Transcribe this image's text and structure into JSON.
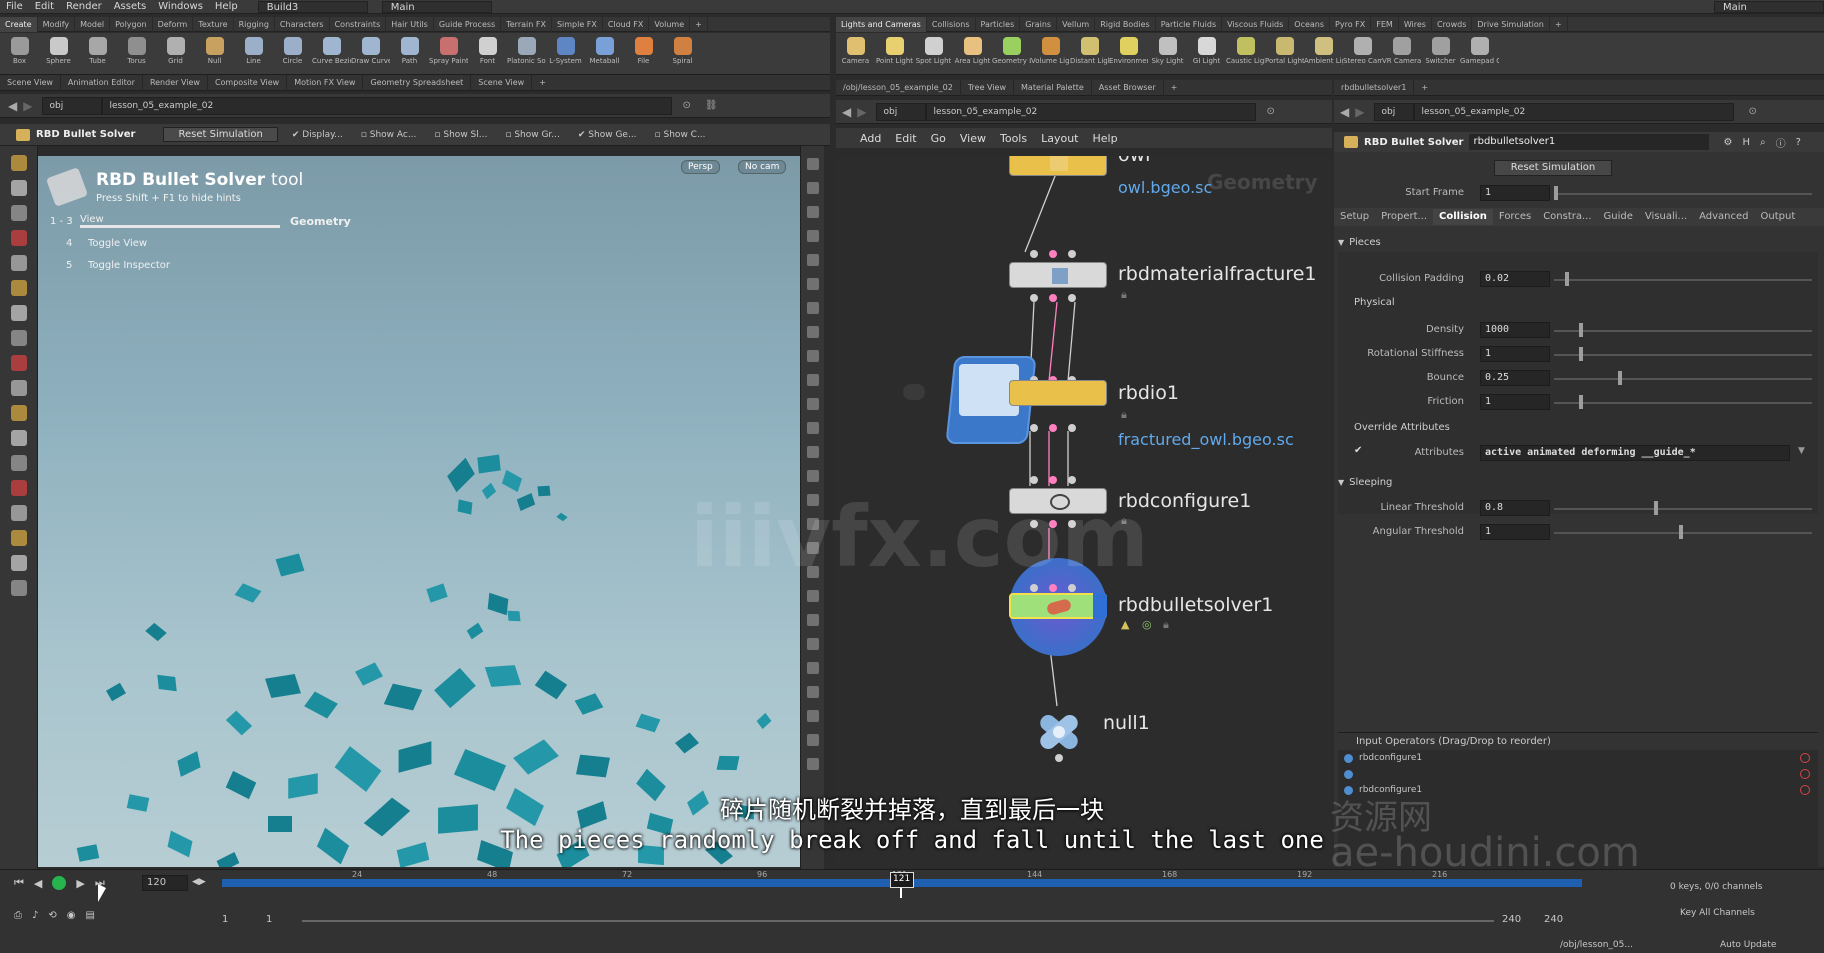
{
  "menubar": {
    "items": [
      "File",
      "Edit",
      "Render",
      "Assets",
      "Windows",
      "Help"
    ],
    "build": "Build3",
    "desktop": "Main",
    "right_desktop": "Main"
  },
  "shelf_left": {
    "tabs": [
      "Create",
      "Modify",
      "Model",
      "Polygon",
      "Deform",
      "Texture",
      "Rigging",
      "Characters",
      "Constraints",
      "Hair Utils",
      "Guide Process",
      "Terrain FX",
      "Simple FX",
      "Cloud FX",
      "Volume"
    ],
    "tools": [
      "Box",
      "Sphere",
      "Tube",
      "Torus",
      "Grid",
      "Null",
      "Line",
      "Circle",
      "Curve Bezier",
      "Draw Curve",
      "Path",
      "Spray Paint",
      "Font",
      "Platonic Solids",
      "L-System",
      "Metaball",
      "File",
      "Spiral"
    ]
  },
  "shelf_right": {
    "tabs": [
      "Lights and Cameras",
      "Collisions",
      "Particles",
      "Grains",
      "Vellum",
      "Rigid Bodies",
      "Particle Fluids",
      "Viscous Fluids",
      "Oceans",
      "Pyro FX",
      "FEM",
      "Wires",
      "Crowds",
      "Drive Simulation"
    ],
    "tools": [
      "Camera",
      "Point Light",
      "Spot Light",
      "Area Light",
      "Geometry Light",
      "Volume Light",
      "Distant Light",
      "Environment Light",
      "Sky Light",
      "GI Light",
      "Caustic Light",
      "Portal Light",
      "Ambient Light",
      "Stereo Camera",
      "VR Camera",
      "Switcher",
      "Gamepad Camera"
    ]
  },
  "scene_pane": {
    "tabs": [
      "Scene View",
      "Animation Editor",
      "Render View",
      "Composite View",
      "Motion FX View",
      "Geometry Spreadsheet",
      "Scene View"
    ],
    "path_root": "obj",
    "path_node": "lesson_05_example_02",
    "tool_name": "RBD Bullet Solver",
    "reset_label": "Reset Simulation",
    "toggles": [
      "Display...",
      "Show Ac...",
      "Show Sl...",
      "Show Gr...",
      "Show Ge...",
      "Show C..."
    ],
    "hud_title": "RBD Bullet Solver",
    "hud_title_suffix": "tool",
    "hud_hint": "Press Shift + F1 to hide hints",
    "hud_keys": [
      {
        "key": "1 - 3",
        "label": "View"
      },
      {
        "key": "4",
        "label": "Toggle View"
      },
      {
        "key": "5",
        "label": "Toggle Inspector"
      }
    ],
    "hud_context": "Geometry",
    "persp": "Persp",
    "cam": "No cam"
  },
  "network_pane": {
    "tabs": [
      "/obj/lesson_05_example_02",
      "Tree View",
      "Material Palette",
      "Asset Browser"
    ],
    "path_root": "obj",
    "path_node": "lesson_05_example_02",
    "menu": [
      "Add",
      "Edit",
      "Go",
      "View",
      "Tools",
      "Layout",
      "Help"
    ],
    "context_label": "Geometry",
    "nodes": [
      {
        "name": "owl",
        "link": "owl.bgeo.sc"
      },
      {
        "name": "rbdmaterialfracture1",
        "link": ""
      },
      {
        "name": "rbdio1",
        "link": "fractured_owl.bgeo.sc"
      },
      {
        "name": "rbdconfigure1",
        "link": ""
      },
      {
        "name": "rbdbulletsolver1",
        "link": ""
      },
      {
        "name": "null1",
        "link": ""
      }
    ],
    "colors": {
      "yellow": "#e8c04a",
      "white": "#d9d9d9",
      "green": "#9fe07a",
      "blue": "#2f6fd6",
      "link": "#61a9ec"
    }
  },
  "param_pane": {
    "tab": "rbdbulletsolver1",
    "path_root": "obj",
    "path_node": "lesson_05_example_02",
    "type_label": "RBD Bullet Solver",
    "node_name": "rbdbulletsolver1",
    "reset_label": "Reset Simulation",
    "start_frame_label": "Start Frame",
    "start_frame": "1",
    "tabs": [
      "Setup",
      "Propert...",
      "Collision",
      "Forces",
      "Constra...",
      "Guide",
      "Visuali...",
      "Advanced",
      "Output"
    ],
    "pieces_header": "Pieces",
    "collision_padding_label": "Collision Padding",
    "collision_padding": "0.02",
    "physical_header": "Physical",
    "density_label": "Density",
    "density": "1000",
    "rot_stiff_label": "Rotational Stiffness",
    "rot_stiff": "1",
    "bounce_label": "Bounce",
    "bounce": "0.25",
    "friction_label": "Friction",
    "friction": "1",
    "override_header": "Override Attributes",
    "attributes_label": "Attributes",
    "attributes": "active animated deforming __guide_*",
    "sleeping_header": "Sleeping",
    "linear_label": "Linear Threshold",
    "linear": "0.8",
    "angular_label": "Angular Threshold",
    "angular": "1",
    "inputs_header": "Input Operators (Drag/Drop to reorder)",
    "inputs": [
      "rbdconfigure1",
      "",
      "rbdconfigure1"
    ]
  },
  "timeline": {
    "frame": "120",
    "current_marker": "121",
    "ticks": [
      "24",
      "48",
      "72",
      "96",
      "121",
      "144",
      "168",
      "192",
      "216"
    ],
    "start": "1",
    "start2": "1",
    "end": "240",
    "end2": "240",
    "keys_info": "0 keys, 0/0 channels",
    "key_all": "Key All Channels",
    "status_path": "/obj/lesson_05...",
    "auto_update": "Auto Update"
  },
  "overlay": {
    "watermark": "iiivfx.com",
    "subtitle_cn": "碎片随机断裂并掉落，直到最后一块",
    "subtitle_en": "The pieces randomly break off and fall until the last one",
    "wm_cn": "资源网",
    "wm_site": "ae-houdini.com"
  }
}
